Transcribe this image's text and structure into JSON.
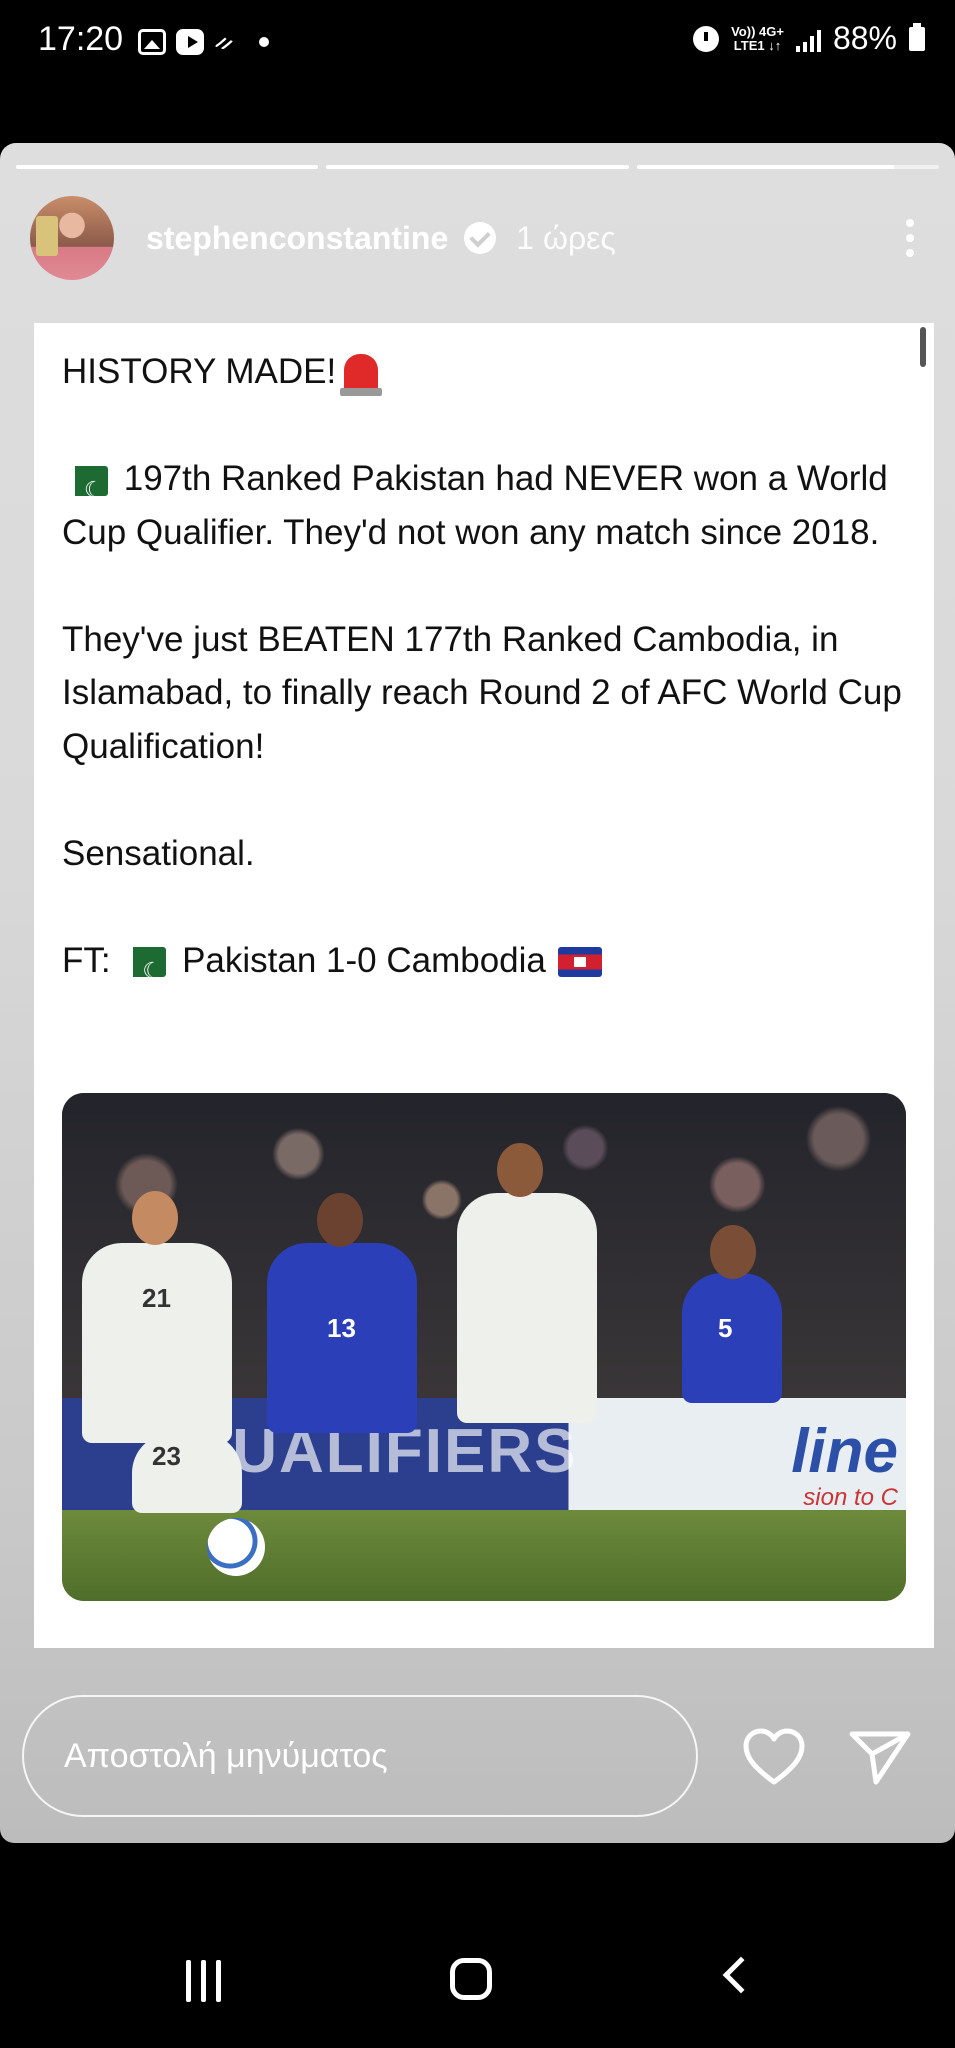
{
  "status_bar": {
    "time": "17:20",
    "battery": "88%",
    "network_top": "Vo)) 4G+",
    "network_bottom": "LTE1 ↓↑"
  },
  "story": {
    "segments": [
      {
        "fill": 1.0
      },
      {
        "fill": 1.0
      },
      {
        "fill": 0.85
      }
    ],
    "username": "stephenconstantine",
    "time_ago": "1 ώρες",
    "post": {
      "line_history": "HISTORY MADE!",
      "para1_text": "197th Ranked Pakistan had NEVER won a World Cup Qualifier. They'd not won any match since 2018.",
      "para2": "They've just BEATEN 177th Ranked Cambodia, in Islamabad, to finally reach Round 2 of AFC World Cup Qualification!",
      "para3": "Sensational.",
      "ft_prefix": "FT:",
      "ft_score": "Pakistan 1-0 Cambodia"
    },
    "photo": {
      "ad_text": "QUALIFIERS",
      "ad_brand": "line",
      "ad_sub": "sion to C",
      "jersey_numbers": [
        "21",
        "13",
        "5",
        "23"
      ]
    }
  },
  "reply": {
    "placeholder": "Αποστολή μηνύματος"
  },
  "icons": {
    "heart": "heart-icon",
    "send": "send-icon",
    "more": "more-vertical-icon",
    "verified": "verified-badge-icon"
  }
}
